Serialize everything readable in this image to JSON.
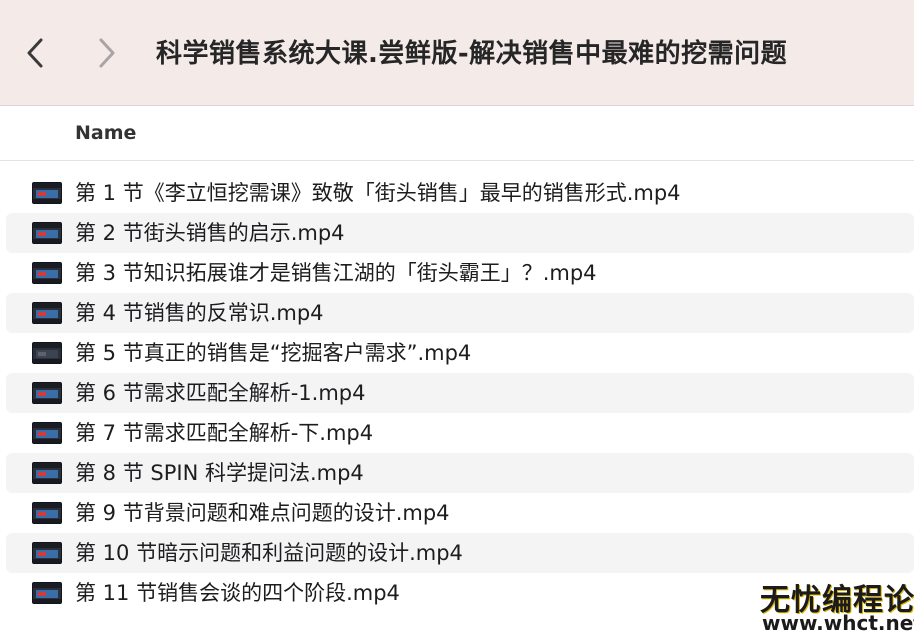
{
  "window": {
    "title": "科学销售系统大课.尝鲜版-解决销售中最难的挖需问题",
    "back_icon": "chevron-left-icon",
    "forward_icon": "chevron-right-icon"
  },
  "list": {
    "column_name": "Name",
    "files": [
      {
        "name": "第 1 节《李立恒挖需课》致敬「街头销售」最早的销售形式.mp4",
        "thumb": "video-thumbnail-icon"
      },
      {
        "name": "第 2 节街头销售的启示.mp4",
        "thumb": "video-thumbnail-icon"
      },
      {
        "name": "第 3 节知识拓展谁才是销售江湖的「街头霸王」？.mp4",
        "thumb": "video-thumbnail-icon"
      },
      {
        "name": "第 4 节销售的反常识.mp4",
        "thumb": "video-thumbnail-icon"
      },
      {
        "name": "第 5 节真正的销售是“挖掘客户需求”.mp4",
        "thumb": "video-thumbnail-icon"
      },
      {
        "name": "第 6 节需求匹配全解析-1.mp4",
        "thumb": "video-thumbnail-icon"
      },
      {
        "name": "第 7 节需求匹配全解析-下.mp4",
        "thumb": "video-thumbnail-icon"
      },
      {
        "name": "第 8 节 SPIN 科学提问法.mp4",
        "thumb": "video-thumbnail-icon"
      },
      {
        "name": "第 9 节背景问题和难点问题的设计.mp4",
        "thumb": "video-thumbnail-icon"
      },
      {
        "name": "第 10 节暗示问题和利益问题的设计.mp4",
        "thumb": "video-thumbnail-icon"
      },
      {
        "name": "第 11 节销售会谈的四个阶段.mp4",
        "thumb": "video-thumbnail-icon"
      }
    ]
  },
  "watermark": {
    "top": "无忧编程论坛",
    "bottom": "www.whct.net"
  },
  "colors": {
    "toolbar_bg": "#f4ebe9",
    "row_alt_bg": "#f4f4f5",
    "text": "#1d1d1f"
  }
}
